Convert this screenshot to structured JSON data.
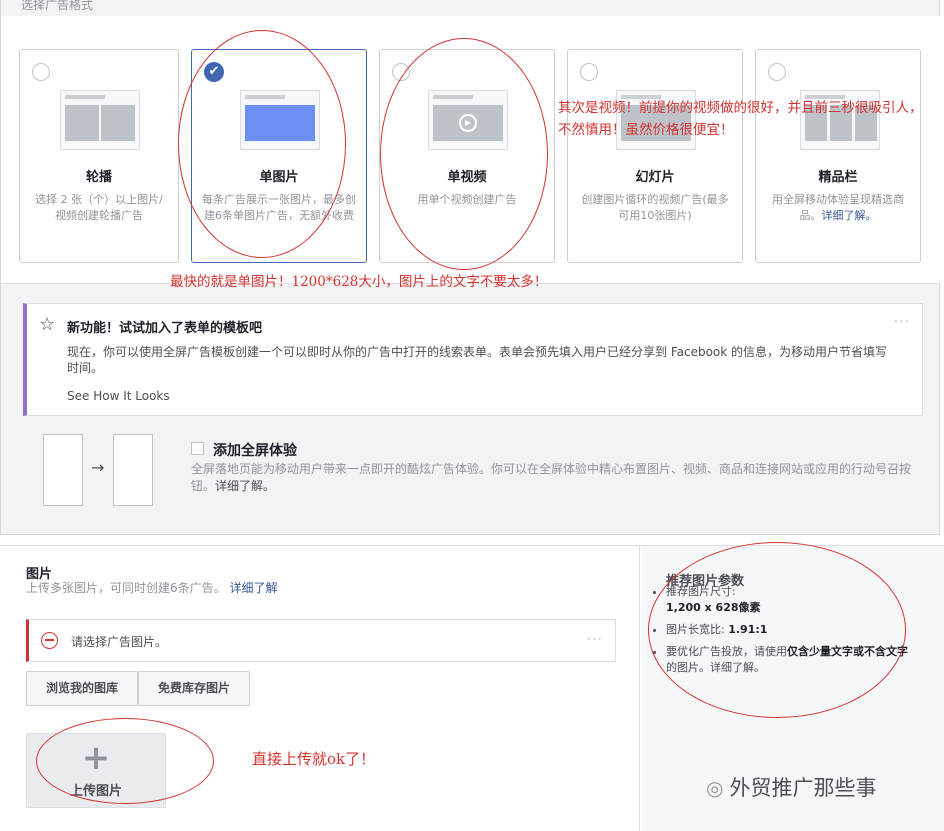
{
  "header": {
    "cut_text": "选择广告格式"
  },
  "formats": [
    {
      "title": "轮播",
      "desc": "选择 2 张（个）以上图片/视频创建轮播广告",
      "selected": false
    },
    {
      "title": "单图片",
      "desc": "每条广告展示一张图片，最多创建6条单图片广告，无额外收费",
      "selected": true
    },
    {
      "title": "单视频",
      "desc": "用单个视频创建广告",
      "selected": false
    },
    {
      "title": "幻灯片",
      "desc": "创建图片循环的视频广告(最多可用10张图片)",
      "selected": false
    },
    {
      "title": "精品栏",
      "desc": "用全屏移动体验呈现精选商品。",
      "link": "详细了解。",
      "selected": false
    }
  ],
  "annotations": {
    "video_note": "其次是视频！前提你的视频做的很好，并且前三秒很吸引人，不然慎用！虽然价格很便宜！",
    "image_note": "最快的就是单图片！1200*628大小，图片上的文字不要太多！",
    "upload_note": "直接上传就ok了！"
  },
  "notice": {
    "title": "新功能！试试加入了表单的模板吧",
    "body": "现在，你可以使用全屏广告模板创建一个可以即时从你的广告中打开的线索表单。表单会预先填入用户已经分享到 Facebook 的信息，为移动用户节省填写时间。",
    "link": "See How It Looks",
    "more": "···"
  },
  "fullscreen": {
    "title": "添加全屏体验",
    "desc": "全屏落地页能为移动用户带来一点即开的酷炫广告体验。你可以在全屏体验中精心布置图片、视频、商品和连接网站或应用的行动号召按钮。",
    "link": "详细了解。",
    "arrow": "→"
  },
  "images": {
    "title": "图片",
    "sub": "上传多张图片，可同时创建6条广告。",
    "sub_link": "详细了解",
    "error": "请选择广告图片。",
    "error_more": "···",
    "browse_btn": "浏览我的图库",
    "stock_btn": "免费库存图片",
    "upload_plus": "+",
    "upload_label": "上传图片"
  },
  "recommend": {
    "title": "推荐图片参数",
    "size_label": "推荐图片尺寸:",
    "size_value": "1,200 x 628像素",
    "ratio_label": "图片长宽比:",
    "ratio_value": "1.91:1",
    "text_pre": "要优化广告投放，请使用",
    "text_bold": "仅含少量文字或不含文字",
    "text_post": "的图片。",
    "text_link": "详细了解。"
  },
  "watermark": {
    "text": "外贸推广那些事",
    "icon": "wechat-icon"
  },
  "colors": {
    "accent": "#4267b2",
    "annotation": "#d3332f",
    "notice_bar": "#8c72cb"
  }
}
